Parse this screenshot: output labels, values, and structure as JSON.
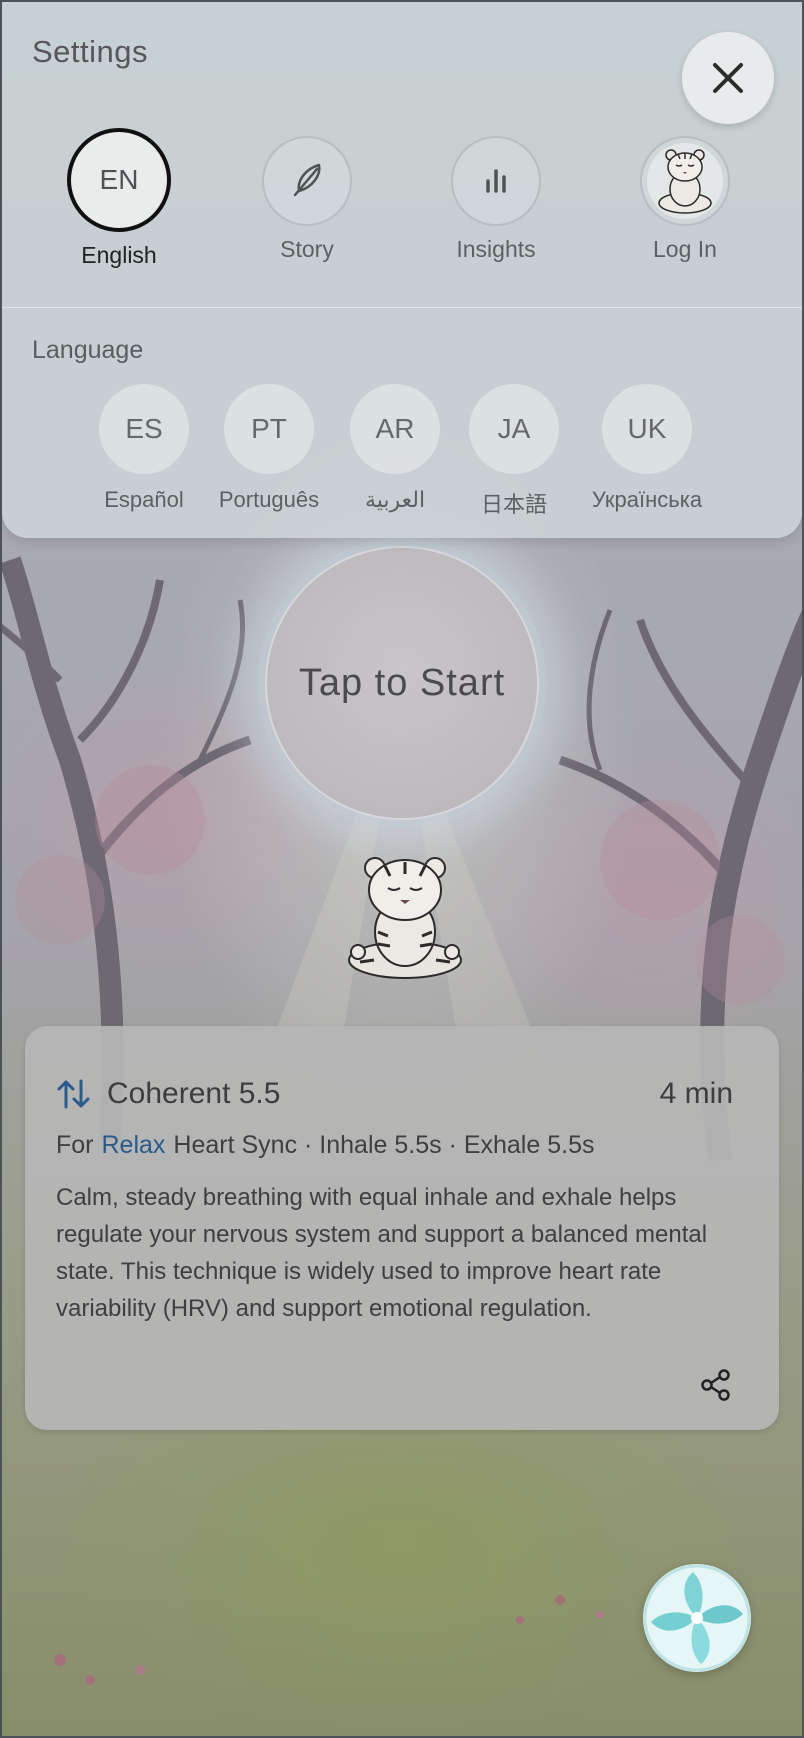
{
  "settings": {
    "title": "Settings",
    "top_items": [
      {
        "code": "EN",
        "label": "English"
      },
      {
        "label": "Story"
      },
      {
        "label": "Insights"
      },
      {
        "label": "Log In"
      }
    ],
    "language_heading": "Language",
    "languages": [
      {
        "code": "ES",
        "label": "Español"
      },
      {
        "code": "PT",
        "label": "Português"
      },
      {
        "code": "AR",
        "label": "العربية"
      },
      {
        "code": "JA",
        "label": "日本語"
      },
      {
        "code": "UK",
        "label": "Українська"
      }
    ]
  },
  "start": {
    "label": "Tap to Start"
  },
  "card": {
    "title": "Coherent 5.5",
    "duration": "4 min",
    "for_prefix": "For",
    "goal": "Relax",
    "details": "Heart Sync · Inhale 5.5s · Exhale 5.5s",
    "description": "Calm, steady breathing with equal inhale and exhale helps regulate your nervous system and support a balanced mental state. This technique is widely used to improve heart rate variability (HRV) and support emotional regulation."
  },
  "icons": {
    "close": "close-icon",
    "story": "feather-icon",
    "insights": "bar-chart-icon",
    "login": "tiger-avatar-icon",
    "swap": "swap-vertical-icon",
    "share": "share-icon",
    "fab": "pinwheel-icon"
  },
  "colors": {
    "accent_blue": "#2a5a8c",
    "active_ring": "#111111",
    "fab_teal": "#7fd3d6"
  }
}
